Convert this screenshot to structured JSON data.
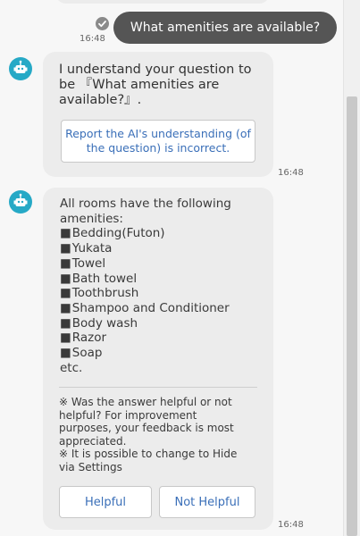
{
  "user_message": {
    "text": "What amenities are available?",
    "time": "16:48"
  },
  "bot_reply_1": {
    "lines": [
      "I understand your question to",
      "be 『What amenities are",
      "available?』."
    ],
    "report_button": "Report the AI's understanding (of the question) is incorrect.",
    "time": "16:48"
  },
  "bot_reply_2": {
    "intro": [
      "All rooms have the following",
      "amenities:"
    ],
    "items": [
      "Bedding(Futon)",
      "Yukata",
      "Towel",
      "Bath towel",
      "Toothbrush",
      "Shampoo and Conditioner",
      "Body wash",
      "Razor",
      "Soap"
    ],
    "etc": "etc.",
    "feedback_lines": [
      "※ Was the answer helpful or not",
      "helpful? For improvement",
      "purposes, your feedback is most",
      "appreciated.",
      "※ It is possible to change to Hide",
      "via Settings"
    ],
    "helpful_label": "Helpful",
    "not_helpful_label": "Not Helpful",
    "time": "16:48"
  },
  "icons": {
    "avatar": "robot-icon",
    "read_status": "check-circle-icon"
  },
  "colors": {
    "user_bubble": "#555555",
    "bot_bubble": "#ececec",
    "avatar": "#26a9c6",
    "link": "#3a6fb8"
  }
}
